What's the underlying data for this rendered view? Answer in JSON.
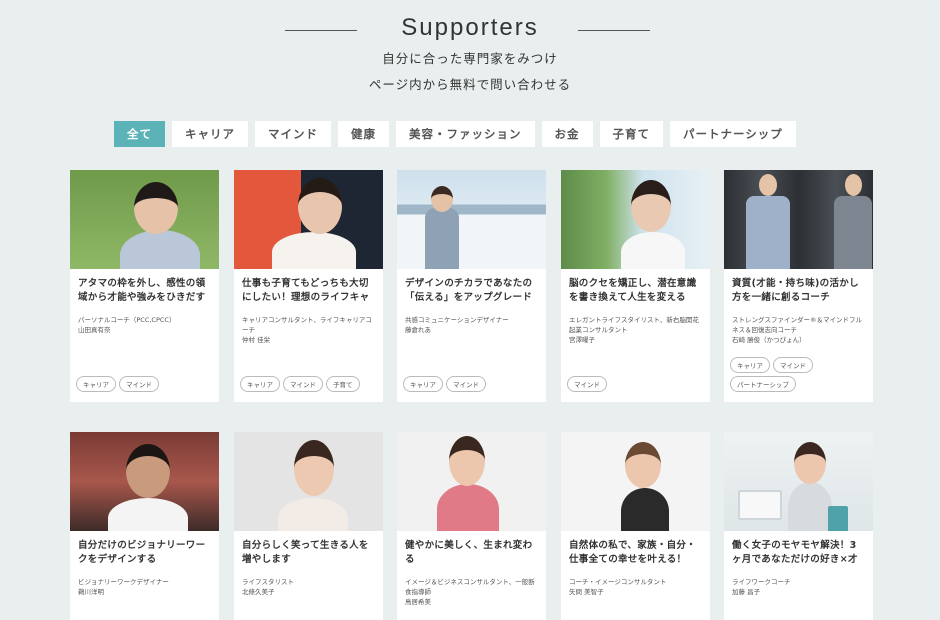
{
  "header": {
    "title": "Supporters",
    "subtitle1": "自分に合った専門家をみつけ",
    "subtitle2": "ページ内から無料で問い合わせる"
  },
  "filters": [
    "全て",
    "キャリア",
    "マインド",
    "健康",
    "美容・ファッション",
    "お金",
    "子育て",
    "パートナーシップ"
  ],
  "active_filter": "全て",
  "colors": {
    "accent": "#5bb3b8",
    "background": "#e9eeee"
  },
  "cards": [
    {
      "title": "アタマの枠を外し、感性の領域から才能や強みをひきだす",
      "role": "パーソナルコーチ（PCC,CPCC）",
      "name": "山田真有奈",
      "tags": [
        "キャリア",
        "マインド"
      ]
    },
    {
      "title": "仕事も子育てもどっちも大切にしたい！理想のライフキャ",
      "role": "キャリアコンサルタント、ライフキャリアコーチ",
      "name": "仲村 佳栄",
      "tags": [
        "キャリア",
        "マインド",
        "子育て"
      ]
    },
    {
      "title": "デザインのチカラであなたの「伝える」をアップグレード",
      "role": "共感コミュニケーションデザイナー",
      "name": "藤倉れあ",
      "tags": [
        "キャリア",
        "マインド"
      ]
    },
    {
      "title": "脳のクセを矯正し、潜在意識を書き換えて人生を変える",
      "role": "エレガントライフスタイリスト、新右脳開花起業コンサルタント",
      "name": "宮澤曜子",
      "tags": [
        "マインド"
      ]
    },
    {
      "title": "資質(才能・持ち味)の活かし方を一緒に創るコーチ",
      "role": "ストレングスファインダー®＆マインドフルネス＆回復志向コーチ",
      "name": "石崎 勝俊（かつぴょん）",
      "tags": [
        "キャリア",
        "マインド",
        "パートナーシップ"
      ]
    },
    {
      "title": "自分だけのビジョナリーワークをデザインする",
      "role": "ビジョナリーワークデザイナー",
      "name": "鵜川洋明",
      "tags": []
    },
    {
      "title": "自分らしく笑って生きる人を増やします",
      "role": "ライフスタリスト",
      "name": "北條久美子",
      "tags": []
    },
    {
      "title": "健やかに美しく、生まれ変わる",
      "role": "イメージ＆ビジネスコンサルタント、一般断食指導師",
      "name": "鳥居希美",
      "tags": []
    },
    {
      "title": "自然体の私で、家族・自分・仕事全ての幸せを叶える！",
      "role": "コーチ・イメージコンサルタント",
      "name": "矢問 美智子",
      "tags": []
    },
    {
      "title": "働く女子のモヤモヤ解決！3ヶ月であなただけの好き×才",
      "role": "ライフワークコーチ",
      "name": "加藤 昌子",
      "tags": []
    }
  ]
}
